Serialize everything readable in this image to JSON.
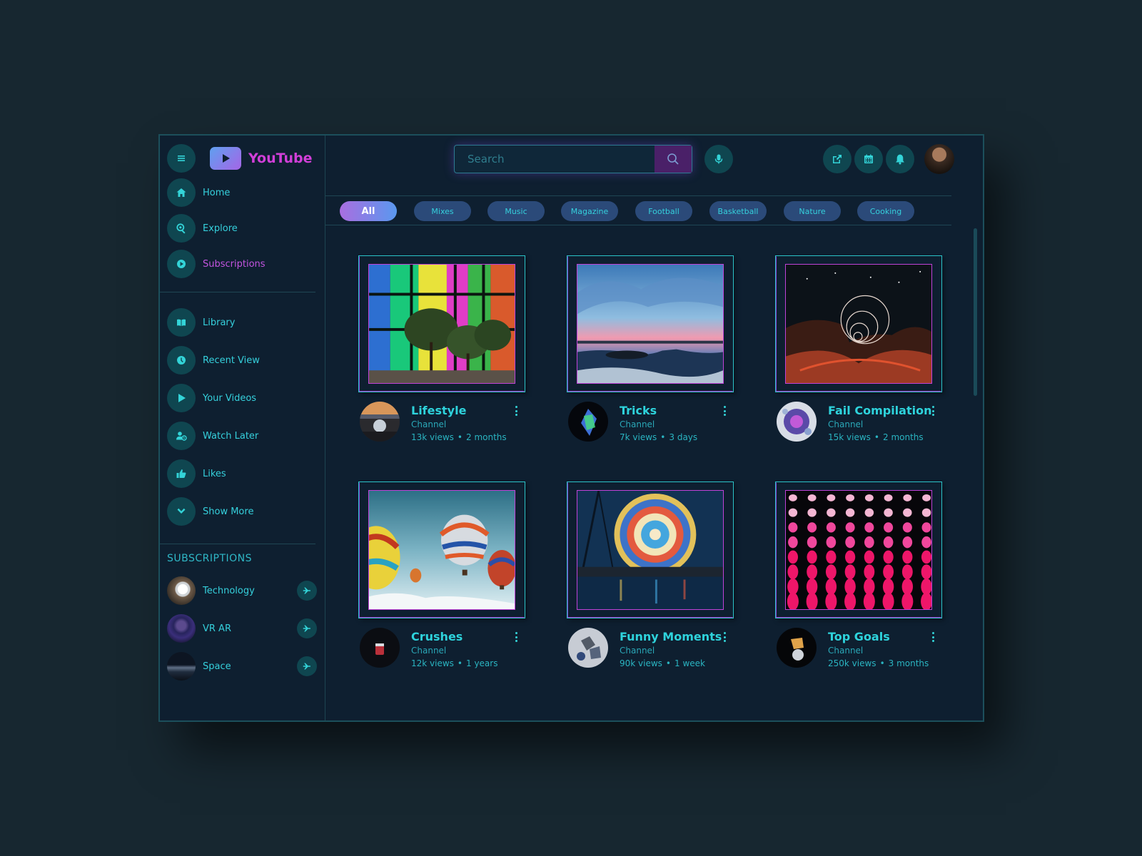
{
  "app": {
    "title": "YouTube"
  },
  "search": {
    "placeholder": "Search"
  },
  "sidebar": {
    "nav": [
      {
        "label": "Home",
        "icon": "home-icon"
      },
      {
        "label": "Explore",
        "icon": "explore-icon"
      },
      {
        "label": "Subscriptions",
        "icon": "subscriptions-icon"
      }
    ],
    "library": [
      {
        "label": "Library",
        "icon": "book-icon"
      },
      {
        "label": "Recent View",
        "icon": "clock-icon"
      },
      {
        "label": "Your Videos",
        "icon": "play-icon"
      },
      {
        "label": "Watch Later",
        "icon": "watch-later-icon"
      },
      {
        "label": "Likes",
        "icon": "thumbs-up-icon"
      },
      {
        "label": "Show More",
        "icon": "chevron-down-icon"
      }
    ],
    "subscriptions_title": "SUBSCRIPTIONS",
    "subscriptions": [
      {
        "label": "Technology"
      },
      {
        "label": "VR AR"
      },
      {
        "label": "Space"
      }
    ]
  },
  "chips": [
    "All",
    "Mixes",
    "Music",
    "Magazine",
    "Football",
    "Basketball",
    "Nature",
    "Cooking"
  ],
  "videos": [
    {
      "title": "Lifestyle",
      "channel": "Channel",
      "views": "13k views",
      "age": "2 months"
    },
    {
      "title": "Tricks",
      "channel": "Channel",
      "views": "7k views",
      "age": "3 days"
    },
    {
      "title": "Fail Compilation",
      "channel": "Channel",
      "views": "15k views",
      "age": "2 months"
    },
    {
      "title": "Crushes",
      "channel": "Channel",
      "views": "12k views",
      "age": "1 years"
    },
    {
      "title": "Funny Moments",
      "channel": "Channel",
      "views": "90k views",
      "age": "1 week"
    },
    {
      "title": "Top Goals",
      "channel": "Channel",
      "views": "250k views",
      "age": "3 months"
    }
  ],
  "colors": {
    "accent": "#33d4d8",
    "brand": "#d13fd8",
    "panel": "#0e1f30"
  }
}
